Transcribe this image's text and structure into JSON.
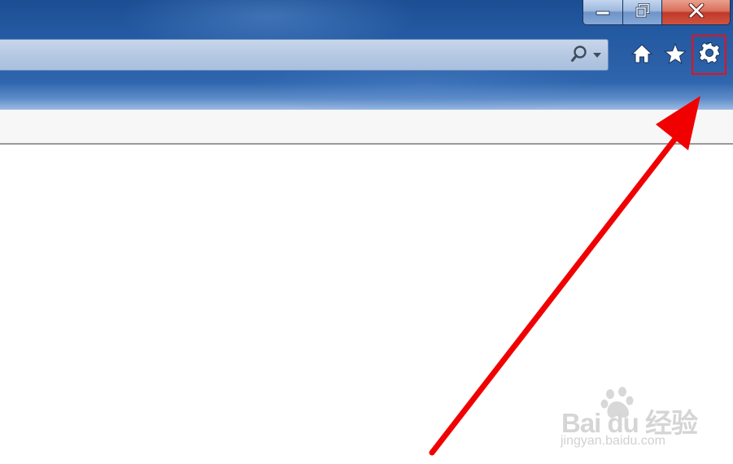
{
  "window": {
    "controls": [
      {
        "name": "minimize-button",
        "icon": "minimize-icon"
      },
      {
        "name": "restore-button",
        "icon": "restore-icon"
      },
      {
        "name": "close-button",
        "icon": "close-icon"
      }
    ]
  },
  "address_bar": {
    "search_icon": "search-icon",
    "dropdown_icon": "dropdown-arrow-icon"
  },
  "toolbar": {
    "icons": [
      "home-icon",
      "favorites-star-icon",
      "tools-gear-icon"
    ],
    "highlight_color": "#e8101a"
  },
  "annotation": {
    "arrow_color": "#f00000",
    "points_to": "tools-gear-icon"
  },
  "watermark": {
    "logo_text": "Bai du 经验",
    "url": "jingyan.baidu.com"
  },
  "colors": {
    "titlebar": "#2a5fa6",
    "address_bar": "#b6c9e3",
    "command_strip": "#f7f7f7",
    "close_button": "#c0392b"
  }
}
